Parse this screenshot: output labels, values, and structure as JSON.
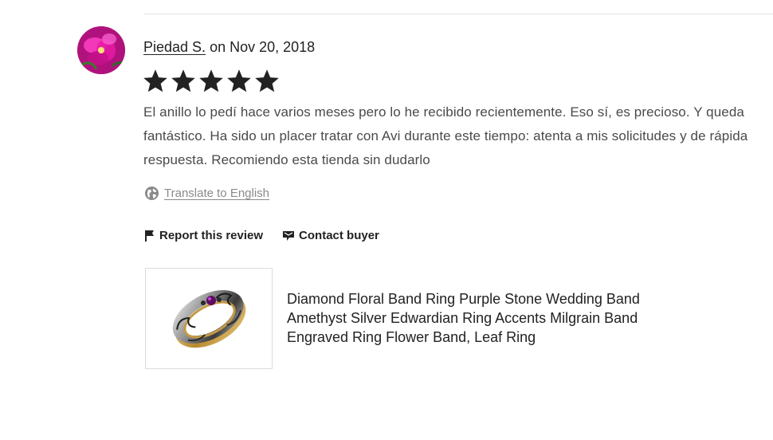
{
  "review": {
    "reviewer_name": "Piedad S.",
    "date_text": "on Nov 20, 2018",
    "rating": 5,
    "rating_max": 5,
    "text": "El anillo lo pedí hace varios meses pero lo he recibido recientemente. Eso sí, es precioso. Y queda fantástico. Ha sido un placer tratar con Avi durante este tiempo: atenta a mis solicitudes y de rápida respuesta. Recomiendo esta tienda sin dudarlo",
    "translate_label": "Translate to English",
    "avatar_icon": "avatar-flower-icon"
  },
  "actions": {
    "report_label": "Report this review",
    "report_icon": "flag-icon",
    "contact_label": "Contact buyer",
    "contact_icon": "message-bubble-icon"
  },
  "listing": {
    "title": "Diamond Floral Band Ring Purple Stone Wedding Band Amethyst Silver Edwardian Ring Accents Milgrain Band Engraved Ring Flower Band, Leaf Ring",
    "thumbnail_icon": "ring-image"
  },
  "colors": {
    "star": "#222222",
    "text": "#4a4a4a",
    "muted": "#8a8a8a",
    "divider": "#e1e3df",
    "avatar_magenta": "#d81b9a"
  }
}
